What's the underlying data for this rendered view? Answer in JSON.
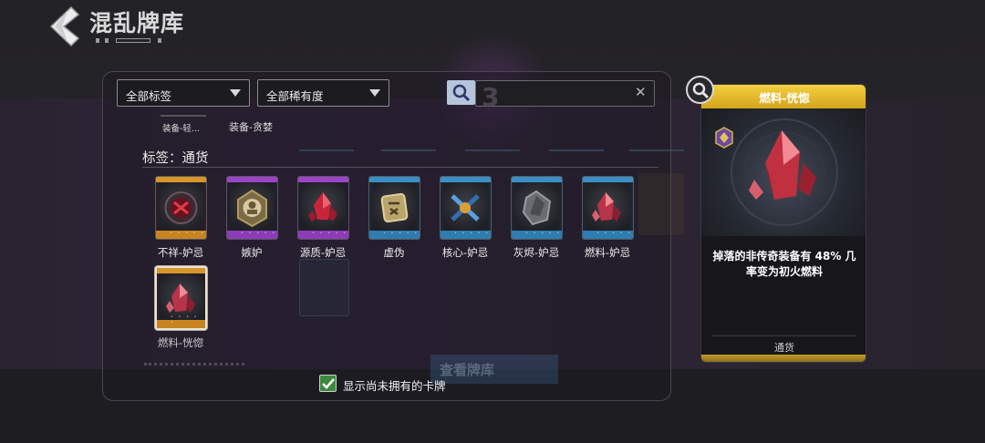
{
  "header": {
    "title": "混乱牌库",
    "back_icon": "chevron-left-icon"
  },
  "filters": {
    "tag_dropdown": "全部标签",
    "rarity_dropdown": "全部稀有度",
    "search_placeholder": "",
    "search_icon": "search-icon",
    "clear_icon": "close-icon"
  },
  "subtabs": [
    "装备-轻...",
    "装备-贪婪"
  ],
  "section": {
    "label": "标签：通货"
  },
  "cards": [
    {
      "name": "不祥-妒忌",
      "color": "#c48a1e",
      "icon": "cursed-seal-icon"
    },
    {
      "name": "嫉妒",
      "color": "#8b3bb5",
      "icon": "bust-medallion-icon"
    },
    {
      "name": "源质-妒忌",
      "color": "#8b3bb5",
      "icon": "red-crystal-icon"
    },
    {
      "name": "虚伪",
      "color": "#2f7fb0",
      "icon": "tablet-icon"
    },
    {
      "name": "核心-妒忌",
      "color": "#2f7fb0",
      "icon": "core-cross-icon"
    },
    {
      "name": "灰烬-妒忌",
      "color": "#2f7fb0",
      "icon": "ash-shard-icon"
    },
    {
      "name": "燃料-妒忌",
      "color": "#2f7fb0",
      "icon": "fuel-crystal-icon"
    },
    {
      "name": "燃料-恍惚",
      "color": "#c48a1e",
      "icon": "fuel-crystal-icon"
    }
  ],
  "ghost_button": "查看牌库",
  "show_unowned": {
    "checked": true,
    "label": "显示尚未拥有的卡牌"
  },
  "detail": {
    "title": "燃料-恍惚",
    "description": "掉落的非传奇装备有 48% 几率变为初火燃料",
    "tag": "通货",
    "rarity_color": "#e2b52a"
  }
}
